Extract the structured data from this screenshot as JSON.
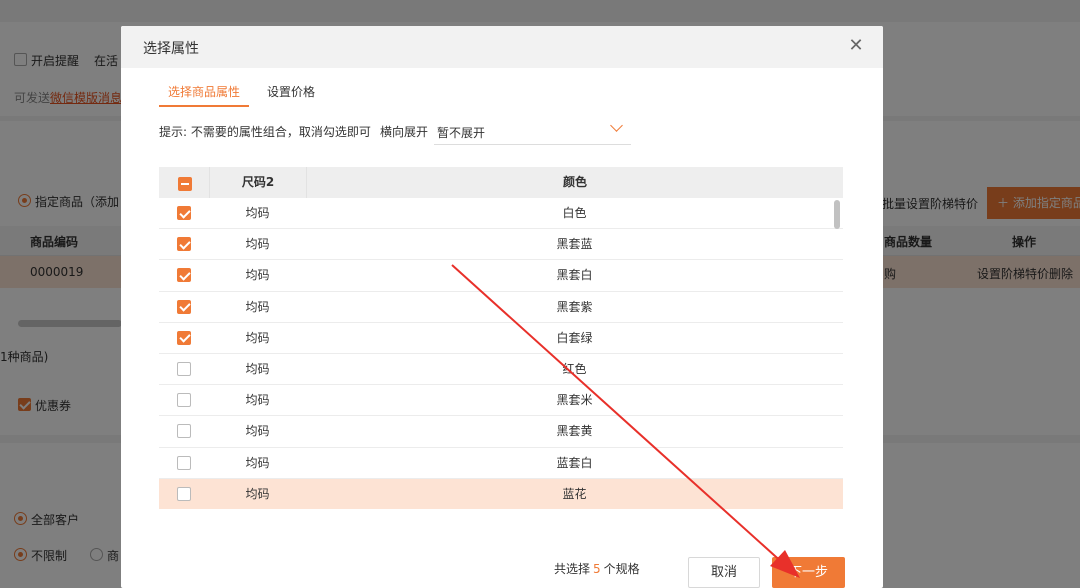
{
  "background": {
    "reminder_label": "开启提醒",
    "in_event_text": "在活",
    "send_text": "可发送",
    "template_link": "微信模版消息",
    "specified_goods": "指定商品（添加",
    "bulk_tier_price": "批量设置阶梯特价",
    "add_goods_button": "＋ 添加指定商品",
    "col_code": "商品编码",
    "col_qty": "商品数量",
    "col_ops": "操作",
    "row_code": "0000019",
    "row_qty": "购",
    "row_ops": "设置阶梯特价删除",
    "goods_count": "1种商品)",
    "coupon_label": "优惠券",
    "all_customers": "全部客户",
    "unlimited": "不限制",
    "other_option": "商"
  },
  "modal": {
    "title": "选择属性",
    "close_icon": "close-icon",
    "tabs": [
      {
        "label": "选择商品属性",
        "active": true
      },
      {
        "label": "设置价格",
        "active": false
      }
    ],
    "hint": "提示: 不需要的属性组合，取消勾选即可",
    "expand_label": "横向展开",
    "expand_value": "暂不展开",
    "columns": {
      "size": "尺码2",
      "color": "颜色"
    },
    "rows": [
      {
        "size": "均码",
        "color": "白色",
        "checked": true
      },
      {
        "size": "均码",
        "color": "黑套蓝",
        "checked": true
      },
      {
        "size": "均码",
        "color": "黑套白",
        "checked": true
      },
      {
        "size": "均码",
        "color": "黑套紫",
        "checked": true
      },
      {
        "size": "均码",
        "color": "白套绿",
        "checked": true
      },
      {
        "size": "均码",
        "color": "红色",
        "checked": false
      },
      {
        "size": "均码",
        "color": "黑套米",
        "checked": false
      },
      {
        "size": "均码",
        "color": "黑套黄",
        "checked": false
      },
      {
        "size": "均码",
        "color": "蓝套白",
        "checked": false
      },
      {
        "size": "均码",
        "color": "蓝花",
        "checked": false
      }
    ],
    "summary_prefix": "共选择",
    "summary_count": "5",
    "summary_suffix": "个规格",
    "cancel_label": "取消",
    "next_label": "下一步"
  },
  "colors": {
    "accent": "#f07a36",
    "arrow": "#e8302a",
    "highlight_row": "#fde3d4"
  }
}
